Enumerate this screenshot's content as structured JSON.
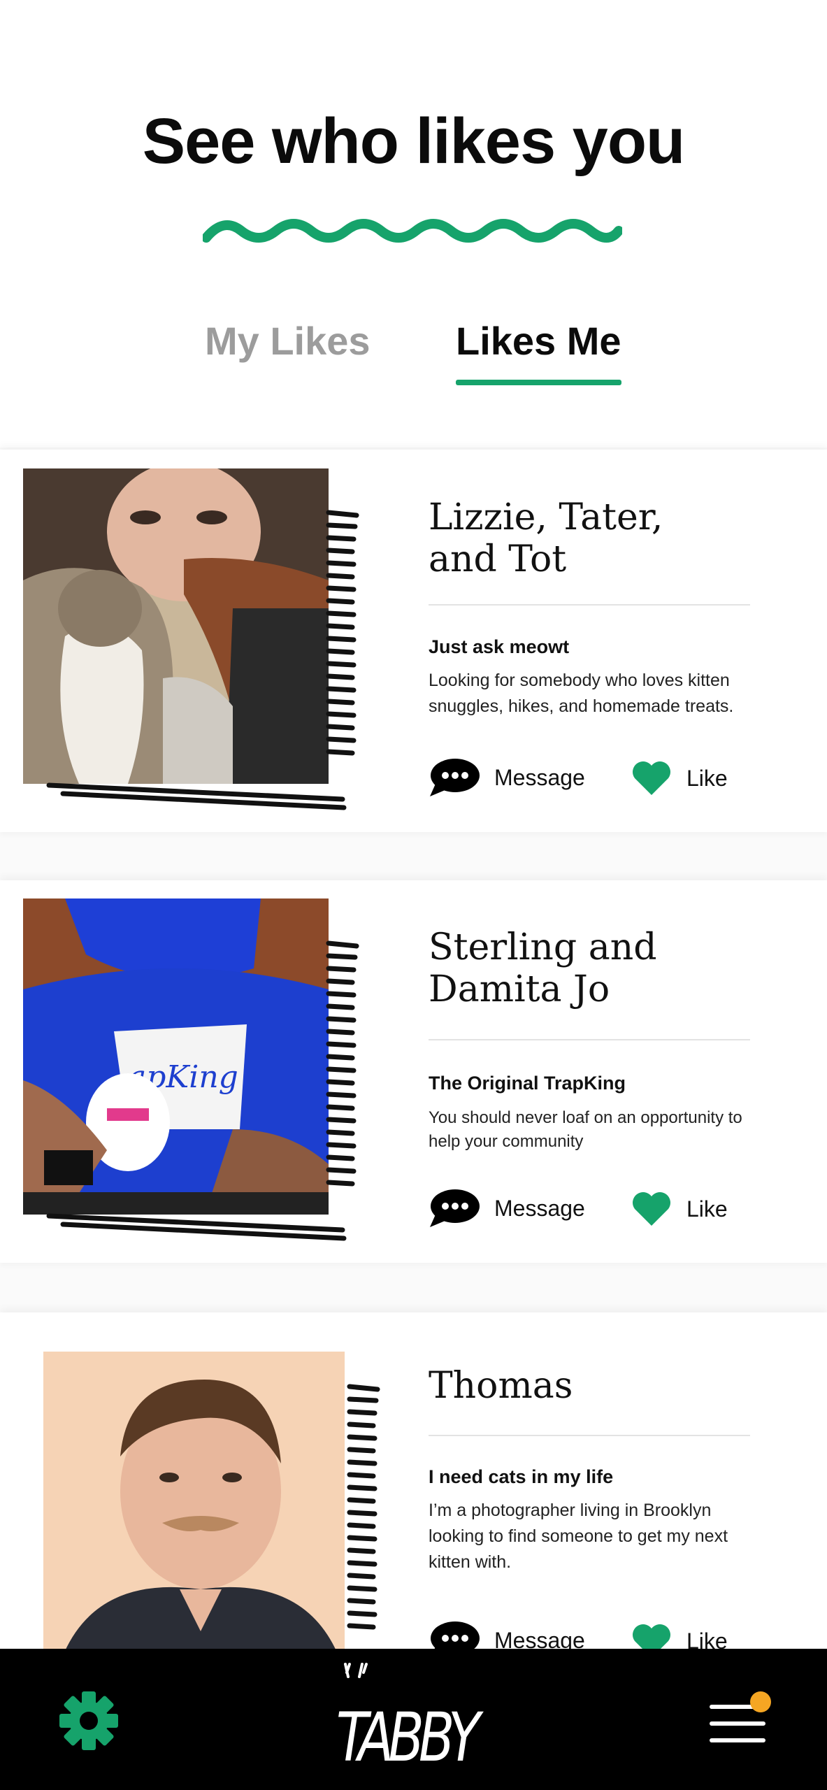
{
  "header": {
    "title": "See who likes you"
  },
  "tabs": [
    {
      "label": "My Likes",
      "active": false
    },
    {
      "label": "Likes Me",
      "active": true
    }
  ],
  "colors": {
    "accent": "#16a36b",
    "notification": "#f5a623"
  },
  "profiles": [
    {
      "name_line1": "Lizzie, Tater,",
      "name_line2": "and Tot",
      "tagline": "Just ask meowt",
      "bio": "Looking for somebody who loves kitten snuggles, hikes, and homemade treats.",
      "message_label": "Message",
      "like_label": "Like"
    },
    {
      "name_line1": "Sterling and",
      "name_line2": "Damita Jo",
      "tagline": "The Original TrapKing",
      "bio": "You should never loaf on an opportunity to help your community",
      "message_label": "Message",
      "like_label": "Like"
    },
    {
      "name_line1": "Thomas",
      "name_line2": "",
      "tagline": "I need cats in my life",
      "bio": "I’m a photographer living in Brooklyn looking to find someone to get my next kitten with.",
      "message_label": "Message",
      "like_label": "Like"
    }
  ],
  "bottom_nav": {
    "logo_text": "TABBY",
    "icons": [
      "gear-icon",
      "tabby-logo",
      "menu-icon"
    ]
  }
}
